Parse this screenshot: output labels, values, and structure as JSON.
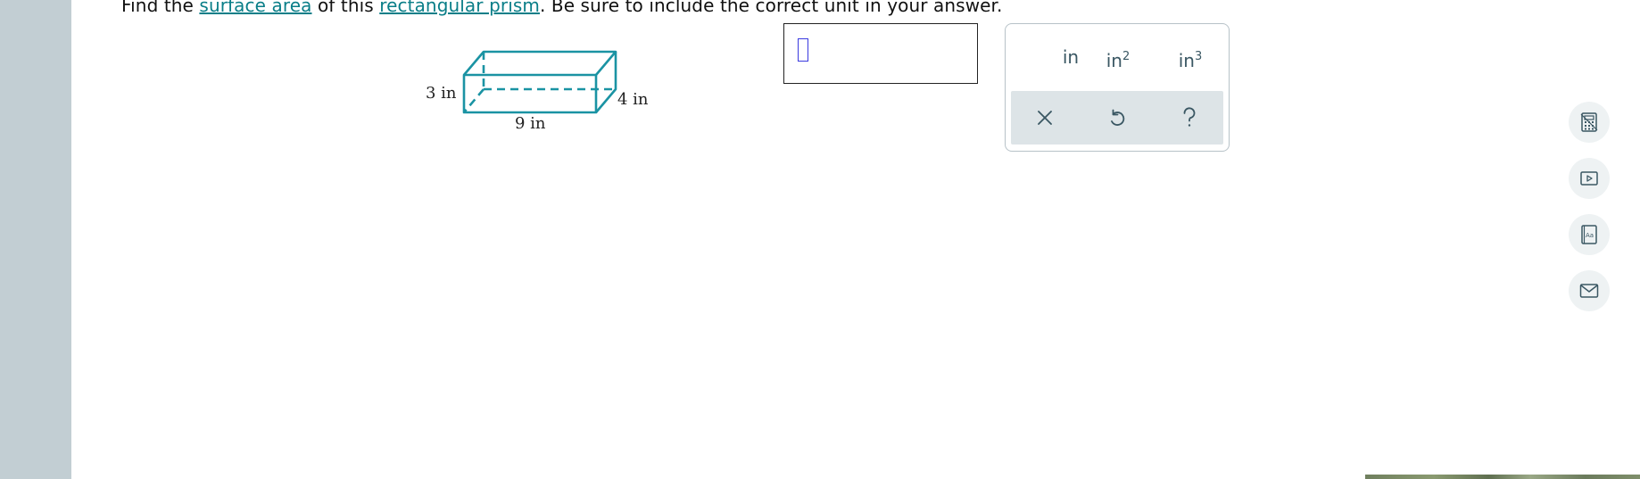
{
  "question": {
    "prefix": "Find the ",
    "link1": "surface area",
    "middle": " of this ",
    "link2": "rectangular prism",
    "suffix": ". Be sure to include the correct unit in your answer."
  },
  "figure": {
    "height_label": "3 in",
    "depth_label": "4 in",
    "length_label": "9 in",
    "stroke_color": "#1a93a3"
  },
  "answer": {
    "value": ""
  },
  "keypad": {
    "units": [
      {
        "base": "in",
        "sup": ""
      },
      {
        "base": "in",
        "sup": "2"
      },
      {
        "base": "in",
        "sup": "3"
      }
    ],
    "actions": [
      "clear-icon",
      "undo-icon",
      "help-icon"
    ]
  },
  "side_tools": [
    "calculator-icon",
    "video-icon",
    "glossary-icon",
    "message-icon"
  ],
  "colors": {
    "accent": "#0a7e88",
    "sidebar": "#c2ced3",
    "keypad_row": "#dde4e7"
  }
}
